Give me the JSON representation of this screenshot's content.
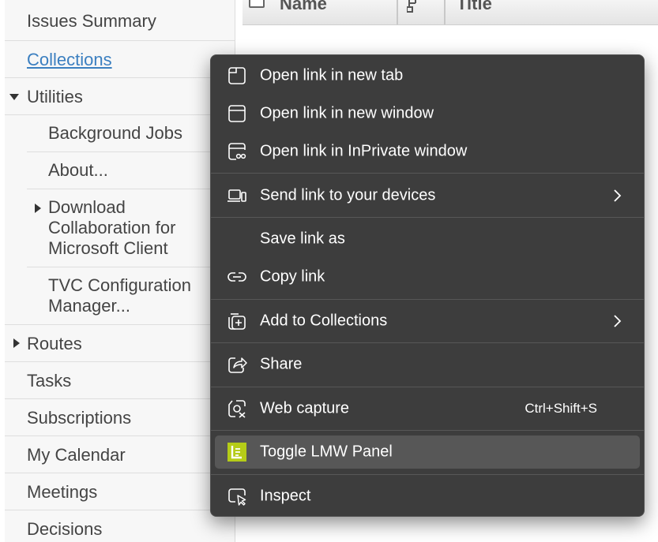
{
  "nav": {
    "items": [
      {
        "label": "Issues Summary"
      },
      {
        "label": "Collections"
      },
      {
        "label": "Utilities"
      },
      {
        "label": "Background Jobs"
      },
      {
        "label": "About..."
      },
      {
        "label": "Download Collaboration for Microsoft Client"
      },
      {
        "label": "TVC Configuration Manager..."
      },
      {
        "label": "Routes"
      },
      {
        "label": "Tasks"
      },
      {
        "label": "Subscriptions"
      },
      {
        "label": "My Calendar"
      },
      {
        "label": "Meetings"
      },
      {
        "label": "Decisions"
      }
    ]
  },
  "table": {
    "columns": [
      {
        "label": "Name"
      },
      {
        "label": "Title"
      }
    ]
  },
  "context_menu": {
    "items": [
      {
        "label": "Open link in new tab",
        "icon": "new-tab-icon"
      },
      {
        "label": "Open link in new window",
        "icon": "new-window-icon"
      },
      {
        "label": "Open link in InPrivate window",
        "icon": "inprivate-window-icon"
      },
      {
        "label": "Send link to your devices",
        "icon": "devices-icon"
      },
      {
        "label": "Save link as"
      },
      {
        "label": "Copy link",
        "icon": "link-icon"
      },
      {
        "label": "Add to Collections",
        "icon": "collections-add-icon"
      },
      {
        "label": "Share",
        "icon": "share-icon"
      },
      {
        "label": "Web capture",
        "icon": "web-capture-icon",
        "shortcut": "Ctrl+Shift+S"
      },
      {
        "label": "Toggle LMW Panel",
        "icon": "lmw-panel-icon"
      },
      {
        "label": "Inspect",
        "icon": "inspect-icon"
      }
    ]
  },
  "colors": {
    "menu_bg": "#3d3d3d",
    "menu_hover": "#575757",
    "link": "#3b7fc0",
    "lmw_accent": "#b5cc18"
  }
}
